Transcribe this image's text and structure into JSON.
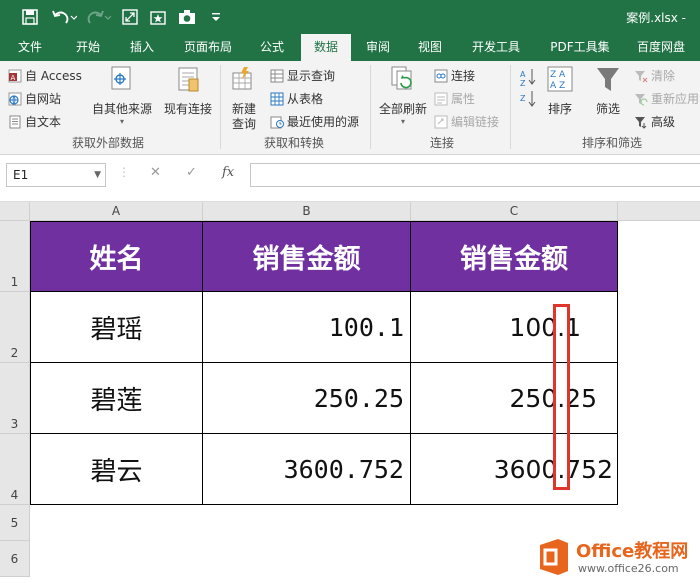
{
  "window": {
    "title": "案例.xlsx -"
  },
  "tabs": [
    "文件",
    "开始",
    "插入",
    "页面布局",
    "公式",
    "数据",
    "审阅",
    "视图",
    "开发工具",
    "PDF工具集",
    "百度网盘"
  ],
  "active_tab": "数据",
  "ribbon": {
    "get_external": {
      "access": "自 Access",
      "web": "自网站",
      "text": "自文本",
      "other": "自其他来源",
      "existing": "现有连接",
      "label": "获取外部数据"
    },
    "get_transform": {
      "new_query_line1": "新建",
      "new_query_line2": "查询",
      "show_queries": "显示查询",
      "from_table": "从表格",
      "recent_sources": "最近使用的源",
      "label": "获取和转换"
    },
    "connections": {
      "refresh_all": "全部刷新",
      "connections": "连接",
      "properties": "属性",
      "edit_links": "编辑链接",
      "label": "连接"
    },
    "sort_filter": {
      "sort": "排序",
      "filter": "筛选",
      "clear": "清除",
      "reapply": "重新应用",
      "advanced": "高级",
      "label": "排序和筛选"
    }
  },
  "formula_bar": {
    "name_box": "E1",
    "cancel": "✕",
    "enter": "✓",
    "fx": "fx",
    "formula": ""
  },
  "sheet": {
    "columns": [
      "A",
      "B",
      "C"
    ],
    "rows": [
      "1",
      "2",
      "3",
      "4",
      "5",
      "6"
    ],
    "header": [
      "姓名",
      "销售金额",
      "销售金额"
    ],
    "data": [
      {
        "name": "碧瑶",
        "b": "100.1",
        "c": "100.1"
      },
      {
        "name": "碧莲",
        "b": "250.25",
        "c": "250.25"
      },
      {
        "name": "碧云",
        "b": "3600.752",
        "c": "3600.752"
      }
    ]
  },
  "watermark": {
    "title": "Office教程网",
    "url": "www.office26.com"
  },
  "colors": {
    "brand": "#217346",
    "header_fill": "#7030a0",
    "highlight": "#e0352b"
  }
}
